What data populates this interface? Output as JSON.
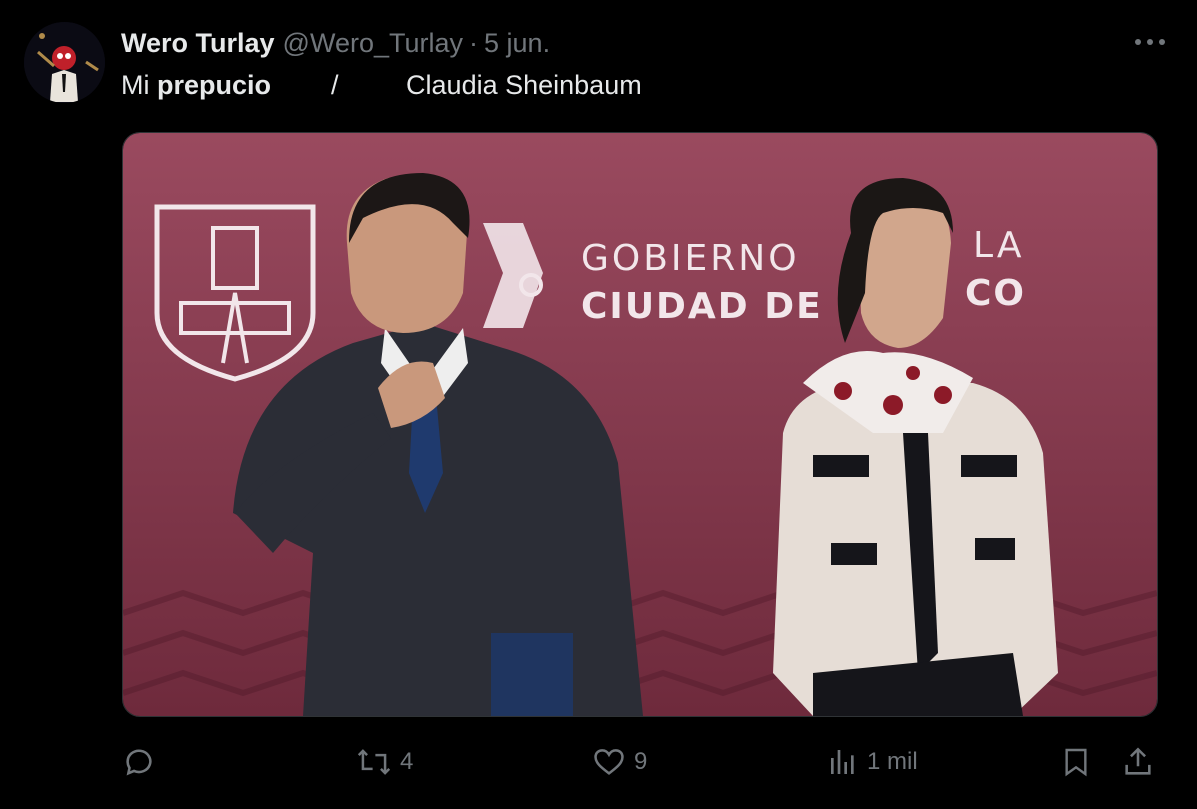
{
  "tweet": {
    "author_name": "Wero Turlay",
    "handle": "@Wero_Turlay",
    "separator": "·",
    "date": "5 jun.",
    "text_part1": "Mi ",
    "text_bold": "prepucio",
    "text_part2": "        /         Claudia Sheinbaum"
  },
  "media": {
    "backdrop_line1": "GOBIERNO",
    "backdrop_line1b": "LA",
    "backdrop_line2": "CIUDAD DE",
    "backdrop_line2b": "CO",
    "colors": {
      "backdrop": "#8a3a50",
      "suit": "#2b2d36",
      "cardigan": "#e6ddd6"
    }
  },
  "actions": {
    "reply_count": "",
    "retweet_count": "4",
    "like_count": "9",
    "views_count": "1 mil"
  },
  "icons": [
    "avatar",
    "more-icon",
    "reply-icon",
    "retweet-icon",
    "like-icon",
    "views-icon",
    "bookmark-icon",
    "share-icon"
  ],
  "colors": {
    "background": "#000000",
    "primary_text": "#e7e9ea",
    "secondary_text": "#71767b"
  }
}
